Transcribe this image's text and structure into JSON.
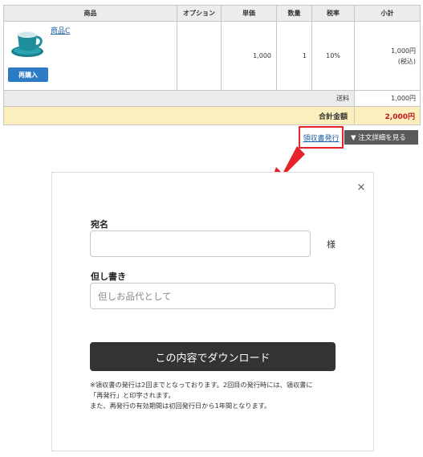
{
  "table": {
    "headers": [
      "商品",
      "オプション",
      "単価",
      "数量",
      "税率",
      "小計"
    ],
    "item": {
      "name": "商品C",
      "rebuy_label": "再購入",
      "option": "",
      "unit_price": "1,000",
      "quantity": "1",
      "tax_rate": "10%",
      "subtotal": "1,000円",
      "subtotal_note": "(税込)"
    },
    "shipping_label": "送料",
    "shipping_value": "1,000円",
    "total_label": "合計金額",
    "total_value": "2,000円"
  },
  "actions": {
    "receipt_label": "領収書発行",
    "order_detail_label": "▼ 注文詳細を見る"
  },
  "modal": {
    "close_label": "×",
    "name_label": "宛名",
    "name_value": "",
    "honorific": "様",
    "note_label": "但し書き",
    "note_placeholder": "但しお品代として",
    "download_label": "この内容でダウンロード",
    "notice_lines": [
      "※領収書の発行は2回までとなっております。2回目の発行時には、領収書に",
      "「再発行」と印字されます。",
      "また、再発行の有効期間は初回発行日から1年間となります。"
    ]
  },
  "colors": {
    "highlight_red": "#e6222a",
    "total_red": "#c0161e",
    "rebuy_blue": "#2e7bc5",
    "link_blue": "#1a5fa8",
    "total_bg": "#fcefbe",
    "download_bg": "#333333"
  },
  "icons": {
    "product_image": "teal-cup-and-saucer",
    "arrow": "red-pointing-arrow",
    "close": "close-icon"
  }
}
